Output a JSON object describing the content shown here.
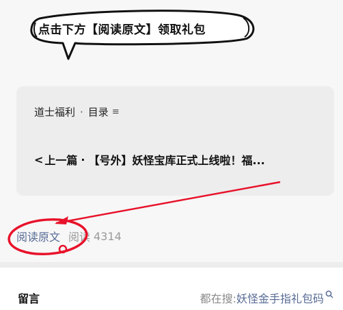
{
  "annotation": {
    "bubble_text": "点击下方【阅读原文】领取礼包",
    "accent_color": "#e8122a"
  },
  "album": {
    "name": "道士福利",
    "separator": "·",
    "catalog_label": "目录",
    "catalog_icon": "list-icon"
  },
  "prev_article": {
    "chevron": "<",
    "label": "上一篇",
    "separator": "·",
    "title": "【号外】妖怪宝库正式上线啦！福..."
  },
  "meta": {
    "read_original": "阅读原文",
    "read_label": "阅读",
    "read_count": "4314"
  },
  "comments": {
    "label": "留言",
    "search_prefix": "都在搜:",
    "search_term": "妖怪金手指礼包码",
    "search_icon": "search-icon"
  },
  "colors": {
    "link": "#576b95",
    "muted": "#9a9a9a",
    "page_bg": "#f7f7f7",
    "card_bg": "#ededed"
  }
}
